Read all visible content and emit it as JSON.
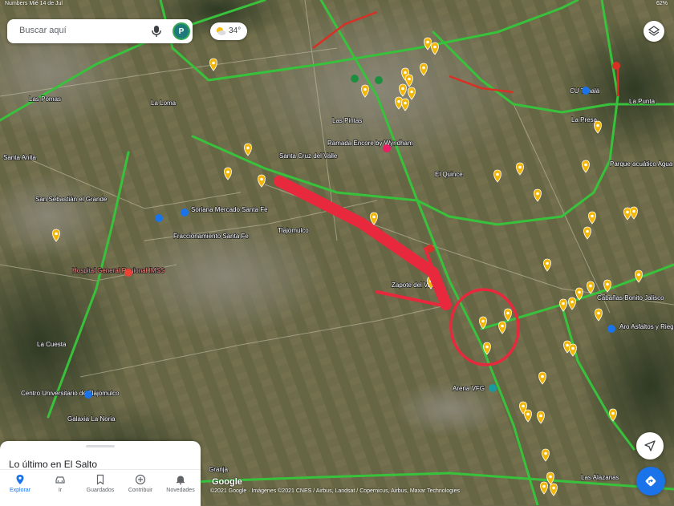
{
  "status_bar": {
    "left": "Numbers   Mié 14 de Jul",
    "right": "62%"
  },
  "search": {
    "placeholder": "Buscar aquí",
    "avatar_letter": "P"
  },
  "weather": {
    "temperature": "34°",
    "icon": "partly-sunny-icon"
  },
  "map": {
    "places": [
      {
        "name": "Las Pomas"
      },
      {
        "name": "La Loma"
      },
      {
        "name": "Las Pintas"
      },
      {
        "name": "Santa Cruz del Valle"
      },
      {
        "name": "Ramada Encore by Wyndham"
      },
      {
        "name": "El Quince"
      },
      {
        "name": "CU Tonalá"
      },
      {
        "name": "La Punta"
      },
      {
        "name": "La Presa"
      },
      {
        "name": "Parque acuático Agua Blanca"
      },
      {
        "name": "San Sebastián el Grande"
      },
      {
        "name": "Soriana Mercado Santa Fe"
      },
      {
        "name": "Fraccionamiento Santa Fe"
      },
      {
        "name": "Tlajomulco"
      },
      {
        "name": "Hospital General Regional IMSS"
      },
      {
        "name": "Zapote del Valle"
      },
      {
        "name": "Cabañas Bonito Jalisco"
      },
      {
        "name": "Aro Asfaltos y Riegos de Occidente"
      },
      {
        "name": "La Cuesta"
      },
      {
        "name": "Centro Universitario de Tlajomulco"
      },
      {
        "name": "Galaxia La Noria"
      },
      {
        "name": "Arena VFG"
      },
      {
        "name": "Granja"
      },
      {
        "name": "Las Alazanas"
      },
      {
        "name": "Santa Anita"
      }
    ]
  },
  "bottom_sheet": {
    "title": "Lo último en El Salto"
  },
  "nav": [
    {
      "label": "Explorar",
      "icon": "location-pin-icon",
      "active": true
    },
    {
      "label": "Ir",
      "icon": "car-icon",
      "active": false
    },
    {
      "label": "Guardados",
      "icon": "bookmark-icon",
      "active": false
    },
    {
      "label": "Contribuir",
      "icon": "plus-circle-icon",
      "active": false
    },
    {
      "label": "Novedades",
      "icon": "bell-icon",
      "active": false
    }
  ],
  "attribution": {
    "logo": "Google",
    "text": "©2021 Google · Imágenes ©2021 CNES / Airbus, Landsat / Copernicus, Airbus, Maxar Technologies"
  },
  "colors": {
    "annotation": "#e8283c",
    "highway": "#38c23c",
    "traffic_red": "#d93025",
    "pin": "#f2b705",
    "accent": "#1a73e8"
  }
}
